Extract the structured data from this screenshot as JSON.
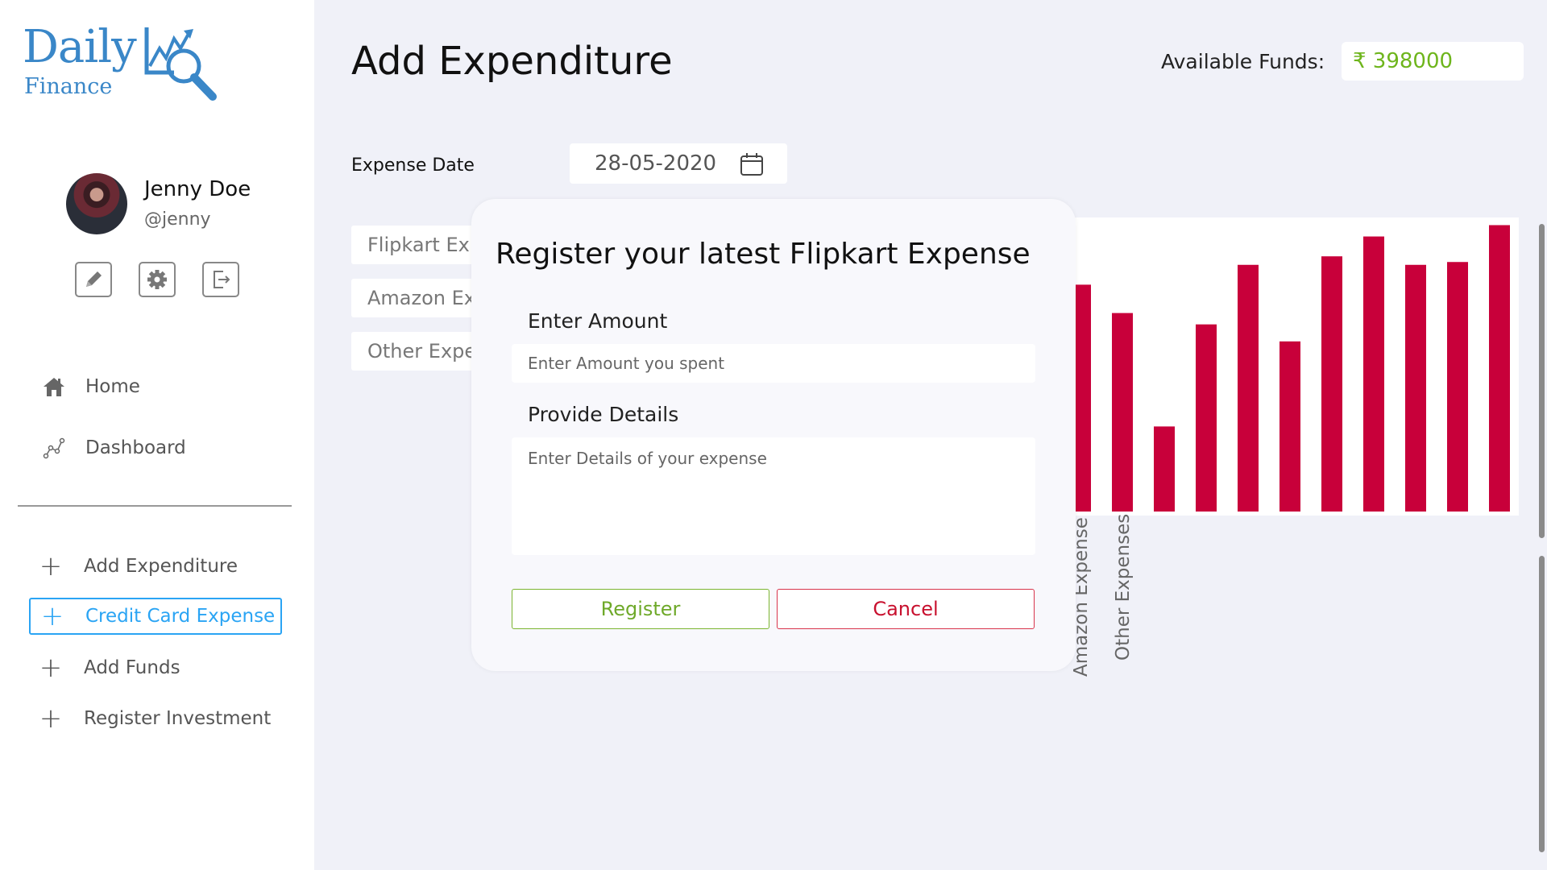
{
  "colors": {
    "brand": "#3a87c8",
    "accent": "#2aa4f4",
    "funds": "#6eb51c",
    "bar": "#c8003a",
    "register": "#6fa92a",
    "cancel": "#c8102e"
  },
  "logo": {
    "word": "Daily",
    "subtitle": "Finance",
    "icon": "chart-magnifier-icon"
  },
  "profile": {
    "name": "Jenny Doe",
    "handle": "@jenny"
  },
  "profile_tools": [
    {
      "icon": "edit-icon"
    },
    {
      "icon": "gear-icon"
    },
    {
      "icon": "logout-icon"
    }
  ],
  "nav": [
    {
      "label": "Home",
      "icon": "home-icon"
    },
    {
      "label": "Dashboard",
      "icon": "graph-icon"
    }
  ],
  "actions": [
    {
      "label": "Add Expenditure",
      "icon": "plus-icon"
    },
    {
      "label": "Credit Card Expense",
      "icon": "plus-icon",
      "active": true
    },
    {
      "label": "Add Funds",
      "icon": "plus-icon"
    },
    {
      "label": "Register Investment",
      "icon": "plus-icon"
    }
  ],
  "main": {
    "title": "Add Expenditure",
    "funds_label": "Available Funds:",
    "funds_value": "₹ 398000",
    "date_label": "Expense Date",
    "date_value": "28-05-2020",
    "expense_buttons": [
      "Flipkart Exp",
      "Amazon Exp",
      "Other Expe"
    ]
  },
  "chart_data": {
    "type": "bar",
    "categories": [
      "Amazon Expense",
      "Other Expenses",
      "",
      "",
      "",
      "",
      "",
      "",
      "",
      "",
      "",
      ""
    ],
    "values": [
      80,
      70,
      30,
      66,
      87,
      60,
      90,
      97,
      87,
      88,
      101
    ]
  },
  "modal": {
    "title": "Register your latest Flipkart Expense",
    "amount_label": "Enter Amount",
    "amount_placeholder": "Enter Amount you spent",
    "details_label": "Provide Details",
    "details_placeholder": "Enter Details of your expense",
    "register_label": "Register",
    "cancel_label": "Cancel"
  }
}
